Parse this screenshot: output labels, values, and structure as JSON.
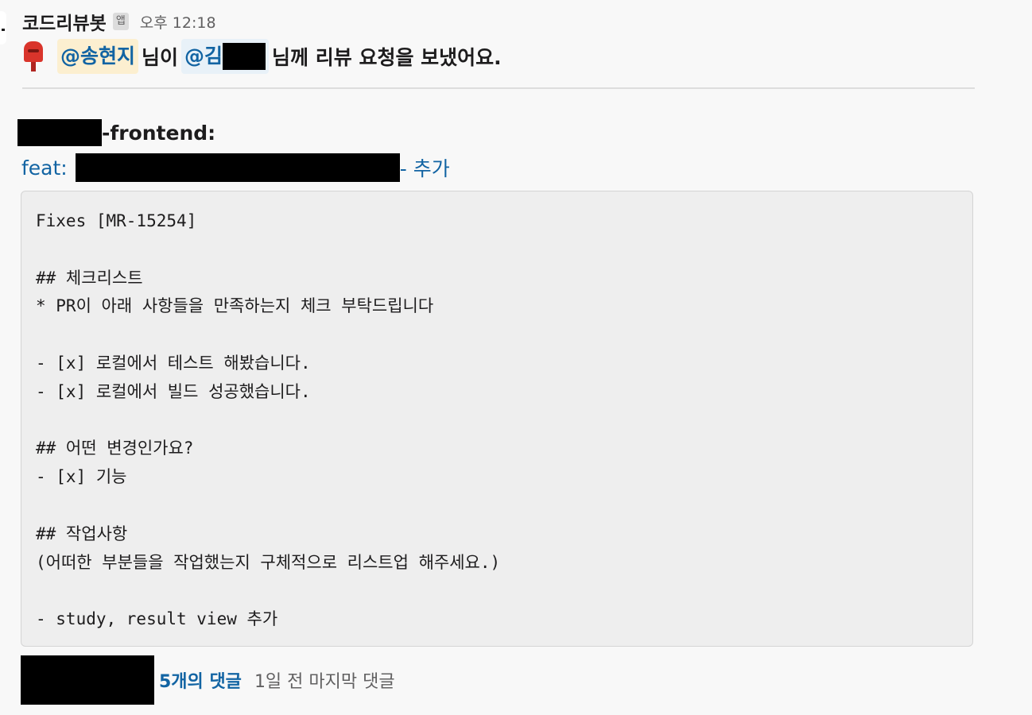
{
  "message": {
    "sender": "코드리뷰봇",
    "app_badge": "앱",
    "timestamp": "오후 12:18",
    "request": {
      "icon": "postbox-icon",
      "mention_self": "@송현지",
      "text_after_self": "님이",
      "mention_other": "@김",
      "text_after_other": "님께 리뷰 요청을 보냈어요."
    },
    "repo": {
      "suffix": "-frontend:"
    },
    "pr_link": {
      "prefix": "feat:",
      "suffix": "- 추가"
    },
    "code_lines": [
      "Fixes [MR-15254]",
      "",
      "## 체크리스트",
      "* PR이 아래 사항들을 만족하는지 체크 부탁드립니다",
      "",
      "- [x] 로컬에서 테스트 해봤습니다.",
      "- [x] 로컬에서 빌드 성공했습니다.",
      "",
      "## 어떤 변경인가요?",
      "- [x] 기능",
      "",
      "## 작업사항",
      "(어떠한 부분들을 작업했는지 구체적으로 리스트업 해주세요.)",
      "",
      "- study, result view 추가"
    ],
    "thread": {
      "replies_label": "5개의 댓글",
      "last_reply": "1일 전 마지막 댓글"
    }
  },
  "colors": {
    "link": "#1264a3",
    "self_mention_bg": "#fcefd0",
    "mention_bg": "#e8f1f8",
    "code_bg": "#eeeeee"
  }
}
